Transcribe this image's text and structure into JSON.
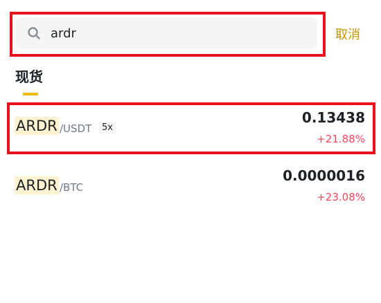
{
  "search": {
    "value": "ardr",
    "cancel_label": "取消"
  },
  "tabs": [
    {
      "label": "现货",
      "active": true
    }
  ],
  "results": [
    {
      "base": "ARDR",
      "quote": "/USDT",
      "leverage": "5x",
      "price": "0.13438",
      "change": "+21.88%"
    },
    {
      "base": "ARDR",
      "quote": "/BTC",
      "price": "0.0000016",
      "change": "+23.08%"
    }
  ],
  "colors": {
    "accent": "#f0b90b",
    "cancel": "#c99400",
    "negative_change": "#f6465d",
    "highlight_box": "#e8121f"
  },
  "icons": {
    "search": "search-icon"
  }
}
